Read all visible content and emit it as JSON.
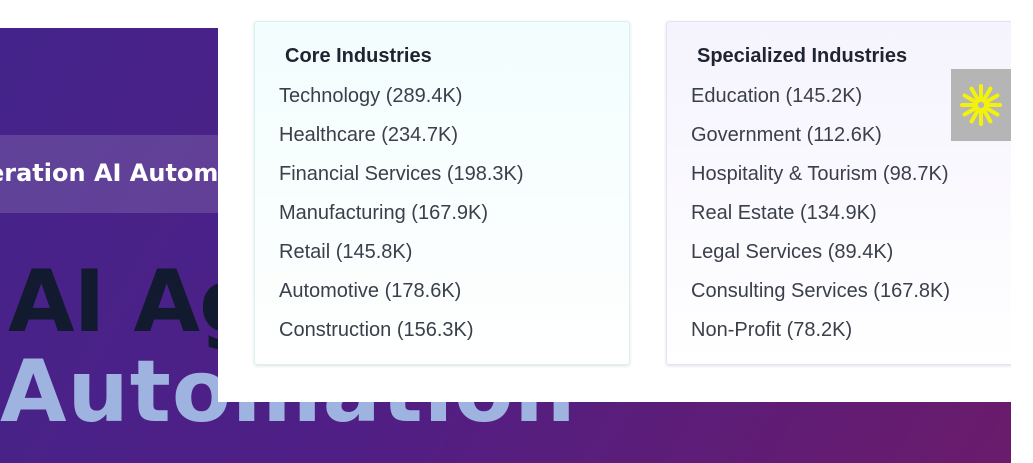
{
  "hero": {
    "badge_text": "eration AI Automa",
    "title_line1": "AI Ag",
    "title_line2": "Automation"
  },
  "dropdown": {
    "core": {
      "title": "Core Industries",
      "items": [
        "Technology (289.4K)",
        "Healthcare (234.7K)",
        "Financial Services (198.3K)",
        "Manufacturing (167.9K)",
        "Retail (145.8K)",
        "Automotive (178.6K)",
        "Construction (156.3K)"
      ]
    },
    "specialized": {
      "title": "Specialized Industries",
      "items": [
        "Education (145.2K)",
        "Government (112.6K)",
        "Hospitality & Tourism (98.7K)",
        "Real Estate (134.9K)",
        "Legal Services (89.4K)",
        "Consulting Services (167.8K)",
        "Non-Profit (78.2K)"
      ]
    }
  },
  "loader": {
    "icon": "asterisk-spinner-icon",
    "color": "#f2f20a"
  },
  "colors": {
    "hero_gradient_start": "#44248a",
    "hero_gradient_end": "#6a1b6b",
    "core_card_bg": "#f2fdfd",
    "specialized_card_bg": "#f5f3fd"
  }
}
